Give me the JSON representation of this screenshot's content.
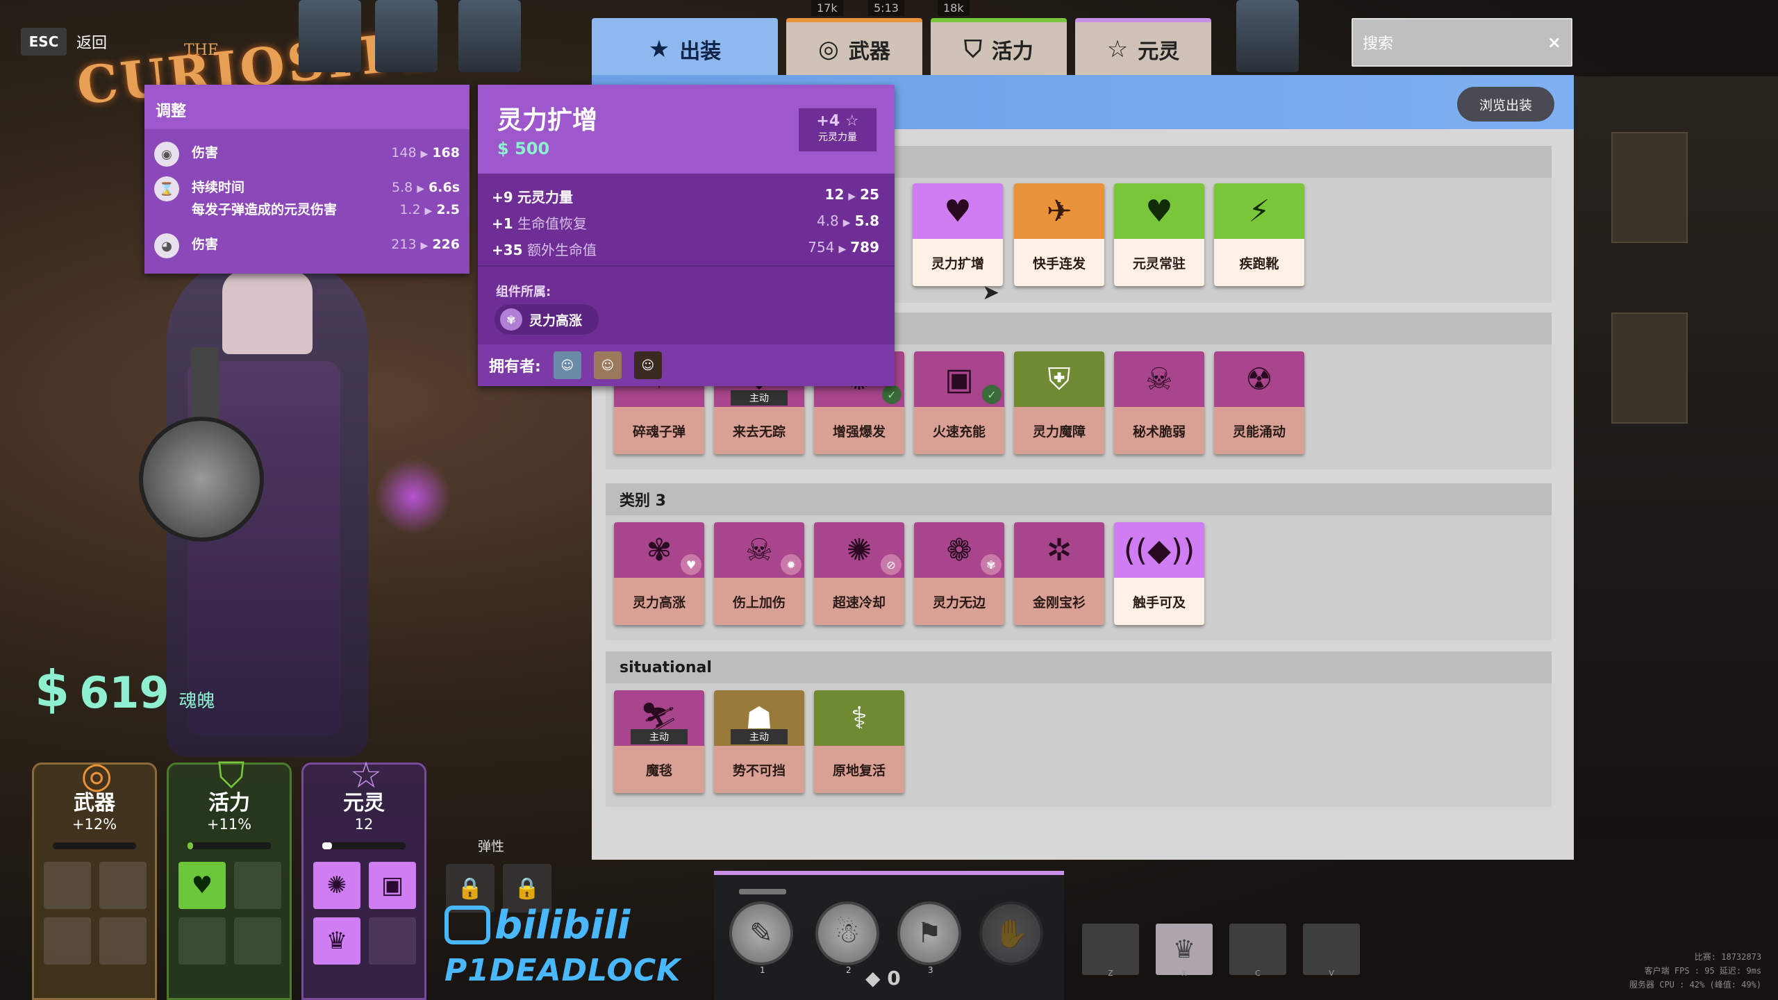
{
  "nav": {
    "esc_key": "ESC",
    "back_label": "返回"
  },
  "scene": {
    "sign_the": "THE",
    "sign_word": "CURIOSITY"
  },
  "top_counters": [
    "17k",
    "5:13",
    "18k"
  ],
  "tabs": [
    {
      "label": "出装",
      "icon": "star-icon",
      "active": true,
      "color": "#8fb8ee"
    },
    {
      "label": "武器",
      "icon": "weapon-target-icon",
      "color": "#e8923a"
    },
    {
      "label": "活力",
      "icon": "vitality-shield-icon",
      "color": "#7ac63a"
    },
    {
      "label": "元灵",
      "icon": "spirit-star-icon",
      "color": "#c98ee8"
    }
  ],
  "search": {
    "placeholder": "搜索",
    "clear": "×"
  },
  "browse_label": "浏览出装",
  "tooltip_adjust": {
    "title": "调整",
    "rows": [
      {
        "label": "伤害",
        "old": "148",
        "new": "168"
      },
      {
        "label": "持续时间",
        "old": "5.8",
        "new": "6.6s"
      },
      {
        "label": "每发子弹造成的元灵伤害",
        "old": "1.2",
        "new": "2.5"
      },
      {
        "label": "伤害",
        "old": "213",
        "new": "226"
      }
    ]
  },
  "tooltip_item": {
    "title": "灵力扩增",
    "cost": "500",
    "bonus_value": "+4",
    "bonus_label": "元灵力量",
    "stats": [
      {
        "amount": "+9",
        "label": "元灵力量",
        "old": "12",
        "new": "25"
      },
      {
        "amount": "+1",
        "label": "生命值恢复",
        "old": "4.8",
        "new": "5.8"
      },
      {
        "amount": "+35",
        "label": "额外生命值",
        "old": "754",
        "new": "789"
      }
    ],
    "component_label": "组件所属:",
    "component_name": "灵力高涨",
    "owners_label": "拥有者:"
  },
  "row1": [
    {
      "name": "灵力扩增",
      "type": "spirit",
      "icon": "heart-bolt-icon",
      "highlight": true
    },
    {
      "name": "快手连发",
      "type": "weapon",
      "icon": "rapid-fire-icon"
    },
    {
      "name": "元灵常驻",
      "type": "vitality",
      "icon": "spirit-heart-icon"
    },
    {
      "name": "疾跑靴",
      "type": "vitality",
      "icon": "sprint-boot-icon"
    }
  ],
  "row2": [
    {
      "name": "碎魂子弹",
      "type": "spirit"
    },
    {
      "name": "来去无踪",
      "type": "spirit",
      "badge": "主动"
    },
    {
      "name": "增强爆发",
      "type": "spirit",
      "owned": true
    },
    {
      "name": "火速充能",
      "type": "spirit",
      "owned": true
    },
    {
      "name": "灵力魔障",
      "type": "vitality-dim"
    },
    {
      "name": "秘术脆弱",
      "type": "spirit"
    },
    {
      "name": "灵能涌动",
      "type": "spirit"
    }
  ],
  "category3": {
    "title": "类别 3",
    "items": [
      {
        "name": "灵力高涨",
        "type": "spirit",
        "pink": true
      },
      {
        "name": "伤上加伤",
        "type": "spirit",
        "pink": true
      },
      {
        "name": "超速冷却",
        "type": "spirit",
        "pink": true
      },
      {
        "name": "灵力无边",
        "type": "spirit",
        "pink": true
      },
      {
        "name": "金刚宝衫",
        "type": "spirit"
      },
      {
        "name": "触手可及",
        "type": "spirit",
        "highlight": true
      }
    ]
  },
  "situational": {
    "title": "situational",
    "items": [
      {
        "name": "魔毯",
        "type": "spirit",
        "badge": "主动"
      },
      {
        "name": "势不可挡",
        "type": "spirit-olive",
        "badge": "主动"
      },
      {
        "name": "原地复活",
        "type": "vitality-dim"
      }
    ]
  },
  "souls": {
    "value": "619",
    "unit": "魂魄"
  },
  "stats": [
    {
      "name": "武器",
      "value": "+12%",
      "color": "#e8923a"
    },
    {
      "name": "活力",
      "value": "+11%",
      "color": "#7ac63a"
    },
    {
      "name": "元灵",
      "value": "12",
      "color": "#c98ee8"
    }
  ],
  "flex_label": "弹性",
  "bilibili": {
    "logo": "bilibili",
    "channel": "P1DEADLOCK"
  },
  "abilities": {
    "points": "0",
    "numbers": [
      "1",
      "2",
      "3"
    ]
  },
  "item_keys": [
    "Z",
    "X",
    "C",
    "V"
  ],
  "debug": {
    "line1": "比赛: 18732873",
    "line2": "客户端 FPS : 95  延迟: 9ms",
    "line3": "服务器 CPU : 42% (峰值: 49%)"
  }
}
